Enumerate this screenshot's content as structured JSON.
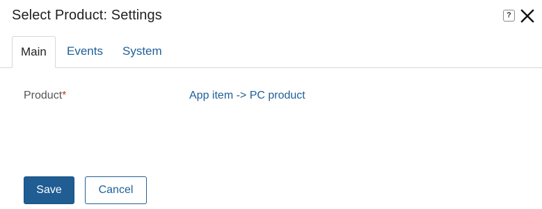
{
  "dialog": {
    "title": "Select Product: Settings",
    "help_label": "?"
  },
  "tabs": [
    {
      "label": "Main",
      "active": true
    },
    {
      "label": "Events",
      "active": false
    },
    {
      "label": "System",
      "active": false
    }
  ],
  "fields": {
    "product": {
      "label": "Product",
      "required_mark": "*",
      "value": "App item -> PC product"
    }
  },
  "footer": {
    "save_label": "Save",
    "cancel_label": "Cancel"
  },
  "colors": {
    "accent": "#1f5d93",
    "link": "#1e5e96",
    "required": "#c0392b"
  }
}
